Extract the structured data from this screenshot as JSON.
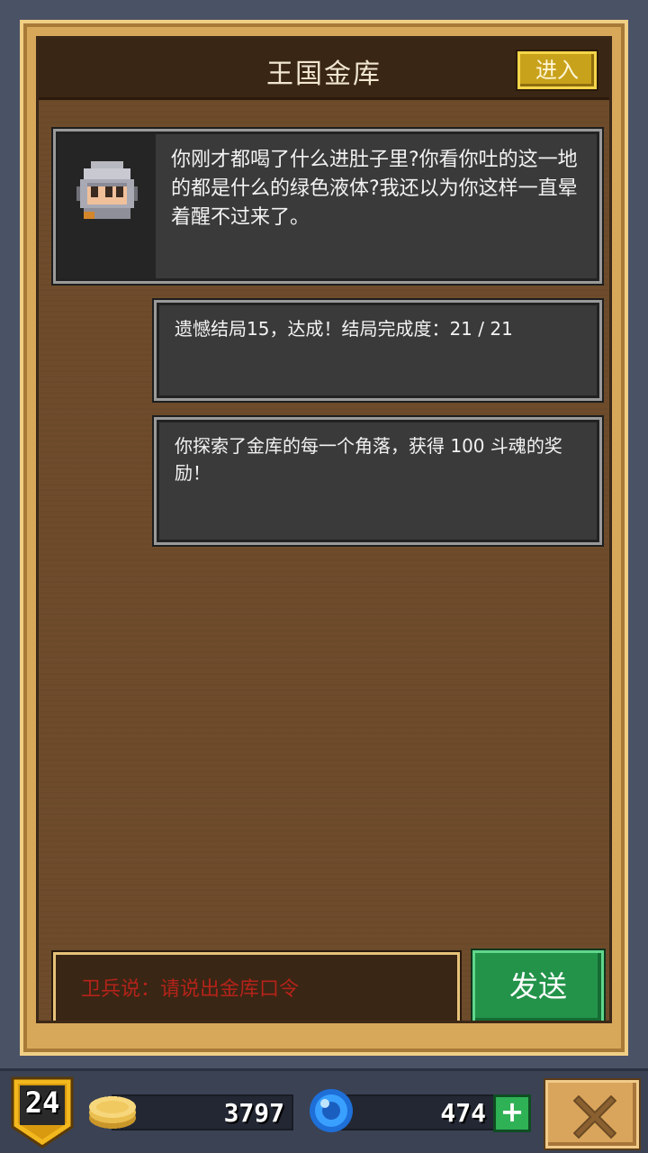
{
  "header": {
    "title": "王国金库",
    "enter_label": "进入"
  },
  "messages": {
    "npc": {
      "avatar_icon": "knight-helmet-icon",
      "text": "你刚才都喝了什么进肚子里?你看你吐的这一地的都是什么的绿色液体?我还以为你这样一直晕着醒不过来了。"
    },
    "system1": "遗憾结局15，达成！结局完成度：21 / 21",
    "system2": "你探索了金库的每一个角落，获得 100 斗魂的奖励！"
  },
  "input": {
    "placeholder": "卫兵说：请说出金库口令",
    "value": ""
  },
  "send_label": "发送",
  "status_bar": {
    "level": "24",
    "coins": "3797",
    "gems": "474",
    "coin_icon": "coin-stack-icon",
    "gem_icon": "blue-gem-icon",
    "plus_icon": "plus-icon",
    "close_icon": "close-icon"
  },
  "colors": {
    "panel_border": "#d8a85a",
    "panel_bg": "#6e4c2b",
    "send_green": "#23934a",
    "enter_gold": "#c9a21c",
    "prompt_red": "#b4231a"
  }
}
